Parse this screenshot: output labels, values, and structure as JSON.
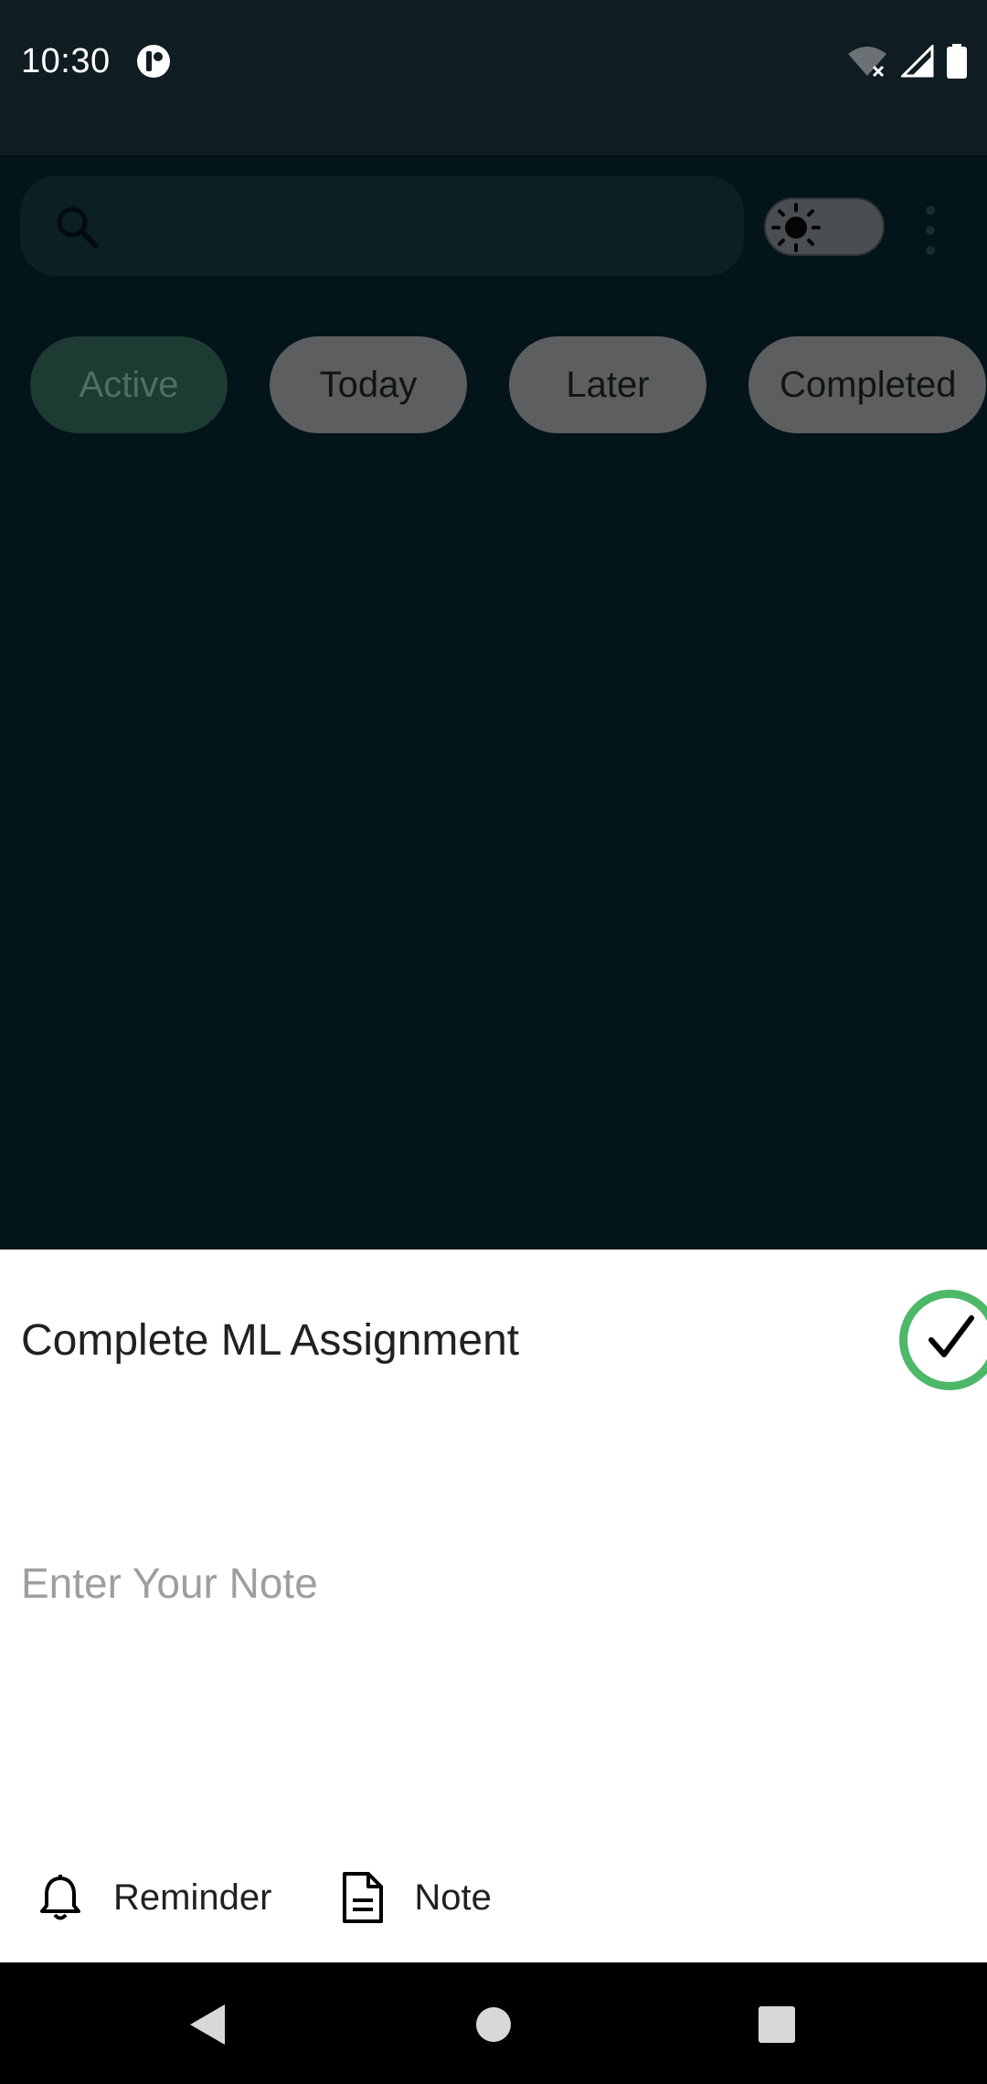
{
  "status_bar": {
    "time": "10:30"
  },
  "search": {
    "placeholder": ""
  },
  "filter_chips": [
    {
      "label": "Active",
      "selected": true
    },
    {
      "label": "Today",
      "selected": false
    },
    {
      "label": "Later",
      "selected": false
    },
    {
      "label": "Completed",
      "selected": false
    }
  ],
  "sheet": {
    "task_title": "Complete ML Assignment",
    "note_placeholder": "Enter Your Note",
    "actions": {
      "reminder_label": "Reminder",
      "note_label": "Note"
    }
  },
  "colors": {
    "accent_green": "#4cb868",
    "background": "#03141a",
    "selected_chip": "#1d3a33"
  },
  "icons": [
    "search-icon",
    "sun-icon",
    "more-vert-icon",
    "check-icon",
    "bell-icon",
    "document-icon",
    "back-icon",
    "home-icon",
    "recents-icon",
    "wifi-icon",
    "signal-icon",
    "battery-icon"
  ]
}
